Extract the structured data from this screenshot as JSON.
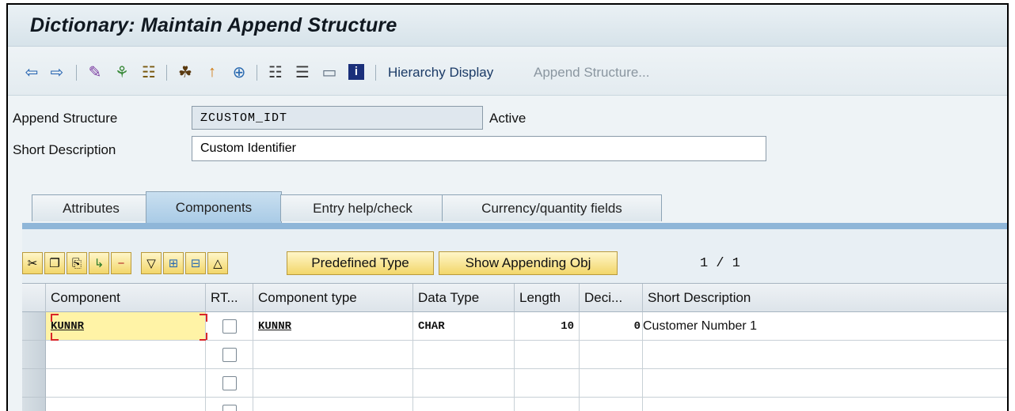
{
  "window": {
    "title": "Dictionary: Maintain Append Structure"
  },
  "toolbar": {
    "icons": [
      "back-arrow-icon",
      "forward-arrow-icon",
      "edit-toggle-icon",
      "activate-icon",
      "display-object-list-icon",
      "where-used-icon",
      "hierarchy-icon",
      "navigate-icon",
      "technical-settings-icon",
      "indexes-icon",
      "screen-icon",
      "info-icon"
    ],
    "hierarchy_display": "Hierarchy Display",
    "append_structure": "Append Structure..."
  },
  "form": {
    "append_label": "Append Structure",
    "append_value": "ZCUSTOM_IDT",
    "status": "Active",
    "desc_label": "Short Description",
    "desc_value": "Custom Identifier"
  },
  "tabs": [
    {
      "label": "Attributes",
      "active": false
    },
    {
      "label": "Components",
      "active": true
    },
    {
      "label": "Entry help/check",
      "active": false
    },
    {
      "label": "Currency/quantity fields",
      "active": false
    }
  ],
  "grid_toolbar": {
    "icons": [
      "cut-icon",
      "copy-icon",
      "paste-icon",
      "insert-row-icon",
      "delete-row-icon",
      "find-icon",
      "expand-icon",
      "collapse-icon",
      "up-icon"
    ],
    "predefined_type": "Predefined Type",
    "show_appending": "Show Appending Obj",
    "pager": "1 / 1"
  },
  "table": {
    "headers": [
      "Component",
      "RT...",
      "Component type",
      "Data Type",
      "Length",
      "Deci...",
      "Short Description"
    ],
    "rows": [
      {
        "component": "KUNNR",
        "rt": false,
        "component_type": "KUNNR",
        "data_type": "CHAR",
        "length": "10",
        "decimals": "0",
        "short_desc": "Customer Number 1"
      },
      {
        "component": "",
        "rt": false,
        "component_type": "",
        "data_type": "",
        "length": "",
        "decimals": "",
        "short_desc": ""
      },
      {
        "component": "",
        "rt": false,
        "component_type": "",
        "data_type": "",
        "length": "",
        "decimals": "",
        "short_desc": ""
      },
      {
        "component": "",
        "rt": false,
        "component_type": "",
        "data_type": "",
        "length": "",
        "decimals": "",
        "short_desc": ""
      }
    ]
  }
}
